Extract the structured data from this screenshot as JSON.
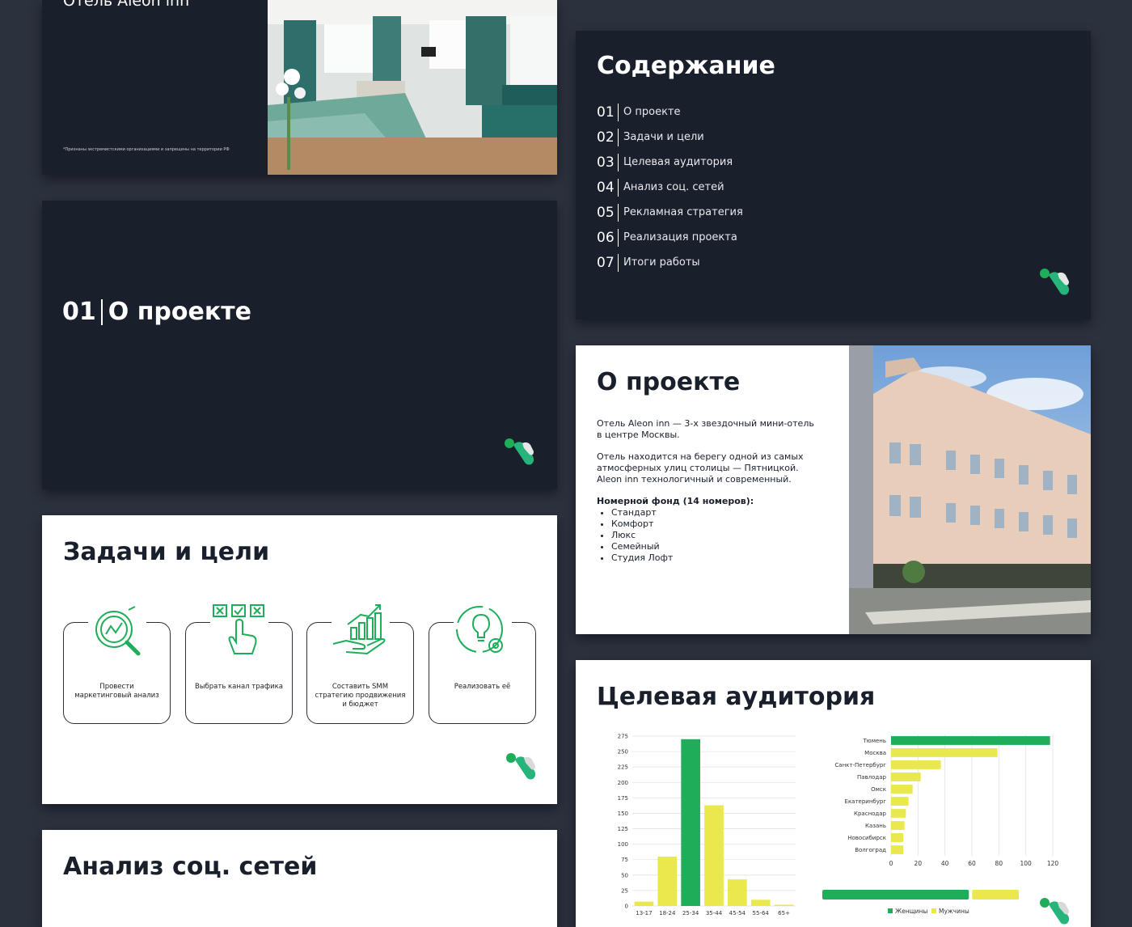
{
  "hotel_slide": {
    "title": "Отель Aleon inn",
    "footnote": "*Признаны экстремистскими организациями и запрещены на территории РФ"
  },
  "contents_slide": {
    "title": "Содержание",
    "items": [
      {
        "num": "01",
        "label": "О проекте"
      },
      {
        "num": "02",
        "label": "Задачи и цели"
      },
      {
        "num": "03",
        "label": "Целевая аудитория"
      },
      {
        "num": "04",
        "label": "Анализ соц. сетей"
      },
      {
        "num": "05",
        "label": "Рекламная стратегия"
      },
      {
        "num": "06",
        "label": "Реализация проекта"
      },
      {
        "num": "07",
        "label": "Итоги работы"
      }
    ]
  },
  "section_slide": {
    "num": "01",
    "title": "О проекте"
  },
  "about_slide": {
    "title": "О проекте",
    "para1": "Отель Aleon inn — 3-х звездочный мини-отель в центре Москвы.",
    "para2": "Отель находится на берегу одной из самых атмосферных улиц столицы — Пятницкой. Aleon inn технологичный и современный.",
    "rooms_title": "Номерной фонд (14 номеров):",
    "rooms": [
      "Стандарт",
      "Комфорт",
      "Люкс",
      "Семейный",
      "Студия Лофт"
    ]
  },
  "goals_slide": {
    "title": "Задачи и цели",
    "cards": [
      {
        "icon": "analytics-magnifier-icon",
        "caption": "Провести маркетинговый анализ"
      },
      {
        "icon": "hand-choose-icon",
        "caption": "Выбрать канал трафика"
      },
      {
        "icon": "hand-growth-chart-icon",
        "caption": "Составить SMM стратегию продвижения и бюджет"
      },
      {
        "icon": "lightbulb-gear-icon",
        "caption": "Реализовать её"
      }
    ]
  },
  "social_slide": {
    "title": "Анализ соц. сетей"
  },
  "audience_slide": {
    "title": "Целевая аудитория"
  },
  "colors": {
    "green": "#1fad5a",
    "yellow": "#e9e84c",
    "dark": "#1a1f2c",
    "bg": "#2c313e"
  },
  "chart_data": [
    {
      "type": "bar",
      "title": "",
      "categories": [
        "13-17",
        "18-24",
        "25-34",
        "35-44",
        "45-54",
        "55-64",
        "65+"
      ],
      "values": [
        7,
        80,
        270,
        163,
        43,
        10,
        2
      ],
      "bar_colors": [
        "yellow",
        "yellow",
        "green",
        "yellow",
        "yellow",
        "yellow",
        "yellow"
      ],
      "yticks": [
        0,
        25,
        50,
        75,
        100,
        125,
        150,
        175,
        200,
        225,
        250,
        275
      ],
      "ylim": [
        0,
        275
      ],
      "grid": true
    },
    {
      "type": "bar",
      "orientation": "horizontal",
      "categories": [
        "Тюмень",
        "Москва",
        "Санкт-Петербург",
        "Павлодар",
        "Омск",
        "Екатеринбург",
        "Краснодар",
        "Казань",
        "Новосибирск",
        "Волгоград"
      ],
      "values": [
        118,
        79,
        37,
        22,
        16,
        13,
        11,
        10,
        9,
        9
      ],
      "bar_colors": [
        "green",
        "yellow",
        "yellow",
        "yellow",
        "yellow",
        "yellow",
        "yellow",
        "yellow",
        "yellow",
        "yellow"
      ],
      "xticks": [
        0,
        20,
        40,
        60,
        80,
        100,
        120
      ],
      "xlim": [
        0,
        120
      ],
      "grid": true
    },
    {
      "type": "bar",
      "orientation": "stacked-horizontal",
      "series": [
        {
          "name": "Женщины",
          "values": [
            75
          ],
          "color": "green"
        },
        {
          "name": "Мужчины",
          "values": [
            25
          ],
          "color": "yellow"
        }
      ],
      "legend": "bottom"
    }
  ]
}
